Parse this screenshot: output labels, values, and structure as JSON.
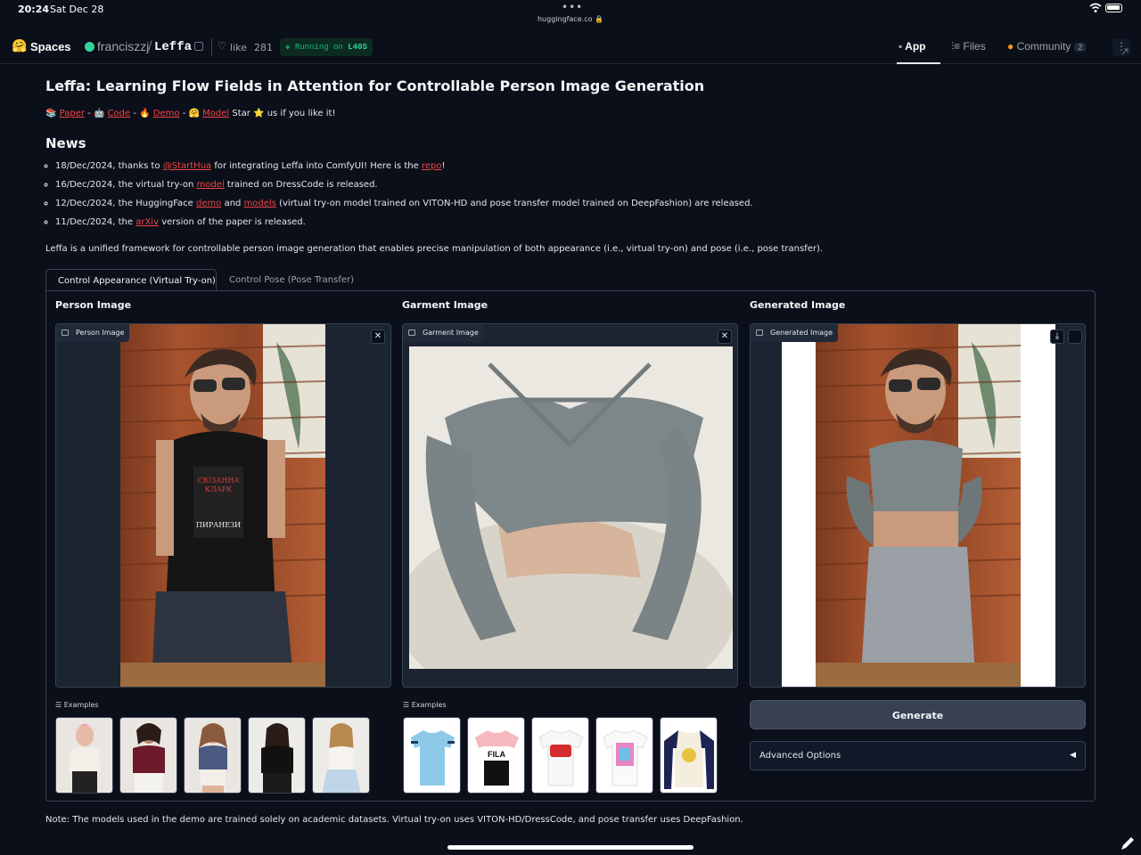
{
  "statusbar": {
    "time": "20:24",
    "date": "Sat Dec 28",
    "url": "huggingface.co"
  },
  "header": {
    "spaces": "Spaces",
    "owner": "franciszzj",
    "repo": "Leffa",
    "like": "like",
    "likes": "281",
    "running": "Running on",
    "hardware": "L40S",
    "nav": {
      "app": "App",
      "files": "Files",
      "community": "Community",
      "community_count": "2"
    }
  },
  "main": {
    "title": "Leffa: Learning Flow Fields in Attention for Controllable Person Image Generation",
    "links": {
      "paper": "Paper",
      "code": "Code",
      "demo": "Demo",
      "model": "Model",
      "star_pre": "Star",
      "star_post": "us if you like it!"
    },
    "news_heading": "News",
    "news": [
      {
        "pre": "18/Dec/2024, thanks to ",
        "link1": "@StartHua",
        "mid": " for integrating Leffa into ComfyUI! Here is the ",
        "link2": "repo",
        "post": "!"
      },
      {
        "pre": "16/Dec/2024, the virtual try-on ",
        "link1": "model",
        "post": " trained on DressCode is released."
      },
      {
        "pre": "12/Dec/2024, the HuggingFace ",
        "link1": "demo",
        "mid": " and ",
        "link2": "models",
        "post": " (virtual try-on model trained on VITON-HD and pose transfer model trained on DeepFashion) are released."
      },
      {
        "pre": "11/Dec/2024, the ",
        "link1": "arXiv",
        "post": " version of the paper is released."
      }
    ],
    "description": "Leffa is a unified framework for controllable person image generation that enables precise manipulation of both appearance (i.e., virtual try-on) and pose (i.e., pose transfer).",
    "tabs": {
      "appearance": "Control Appearance (Virtual Try-on)",
      "pose": "Control Pose (Pose Transfer)"
    },
    "person": {
      "title": "Person Image",
      "label": "Person Image",
      "book_line1": "СЮЗАННА",
      "book_line2": "КЛАРК",
      "book_title": "ПИРАНЕЗИ"
    },
    "garment": {
      "title": "Garment Image",
      "label": "Garment Image"
    },
    "generated": {
      "title": "Generated Image",
      "label": "Generated Image"
    },
    "examples_label": "Examples",
    "tee_texts": [
      "FILA"
    ],
    "generate": "Generate",
    "advanced": "Advanced Options",
    "note": "Note: The models used in the demo are trained solely on academic datasets. Virtual try-on uses VITON-HD/DressCode, and pose transfer uses DeepFashion."
  },
  "colors": {
    "accent_link": "#ef4444",
    "running": "#10b981",
    "background": "#0b0f19"
  }
}
